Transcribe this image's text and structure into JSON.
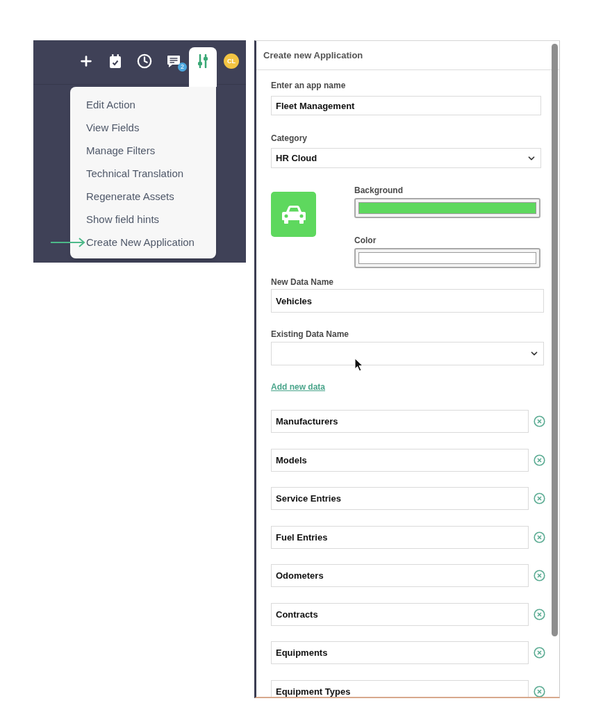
{
  "toolbar": {
    "buttons": [
      {
        "selected": false
      },
      {
        "selected": false
      },
      {
        "selected": false
      },
      {
        "selected": false,
        "badge": "2"
      },
      {
        "selected": true
      }
    ],
    "avatar": "CL"
  },
  "menu": {
    "items": [
      {
        "label": "Edit Action",
        "marked": false
      },
      {
        "label": "View Fields",
        "marked": false
      },
      {
        "label": "Manage Filters",
        "marked": false
      },
      {
        "label": "Technical Translation",
        "marked": false
      },
      {
        "label": "Regenerate Assets",
        "marked": false
      },
      {
        "label": "Show field hints",
        "marked": false
      },
      {
        "label": "Create New Application",
        "marked": true
      }
    ]
  },
  "dialog": {
    "title": "Create new Application",
    "app_name": {
      "label": "Enter an app name",
      "value": "Fleet Management"
    },
    "category": {
      "label": "Category",
      "value": "HR Cloud"
    },
    "background": {
      "label": "Background",
      "color": "#5ed85e"
    },
    "icon_color": {
      "label": "Color",
      "color": "#ffffff"
    },
    "new_data_name": {
      "label": "New Data Name",
      "value": "Vehicles"
    },
    "existing_data_name": {
      "label": "Existing Data Name"
    },
    "add_link": "Add new data",
    "data_items": [
      "Manufacturers",
      "Models",
      "Service Entries",
      "Fuel Entries",
      "Odometers",
      "Contracts",
      "Equipments",
      "Equipment Types"
    ]
  }
}
